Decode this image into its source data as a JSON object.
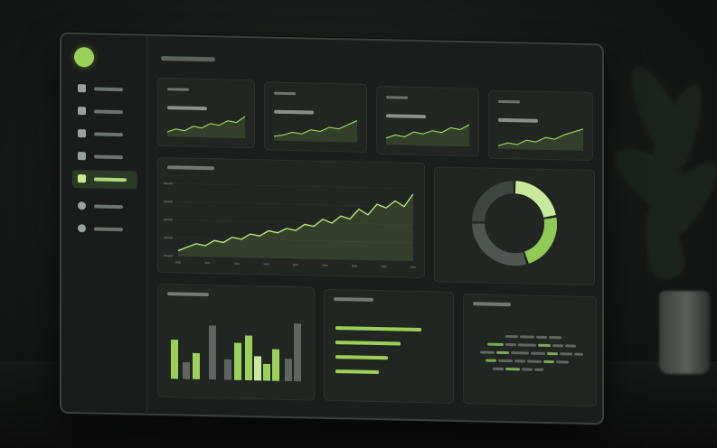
{
  "theme": {
    "accent": "#9bd159",
    "accent_light": "#c9ea9c",
    "panel": "#222623",
    "background": "#151816"
  },
  "sidebar": {
    "logo_icon": "logo-circle-icon",
    "items": [
      {
        "icon": "home-icon",
        "label": "",
        "active": false
      },
      {
        "icon": "box-icon",
        "label": "",
        "active": false
      },
      {
        "icon": "grid-icon",
        "label": "",
        "active": false
      },
      {
        "icon": "calendar-icon",
        "label": "",
        "active": false
      },
      {
        "icon": "chart-icon",
        "label": "",
        "active": true
      },
      {
        "icon": "user-icon",
        "label": "",
        "active": false
      },
      {
        "icon": "settings-icon",
        "label": "",
        "active": false
      }
    ]
  },
  "header": {
    "title": ""
  },
  "kpi_cards": [
    {
      "title": "",
      "value": ""
    },
    {
      "title": "",
      "value": ""
    },
    {
      "title": "",
      "value": ""
    },
    {
      "title": "",
      "value": ""
    }
  ],
  "panels": {
    "line_title": "",
    "bar_title": "",
    "list_title": "",
    "tags_title": ""
  },
  "chart_data": [
    {
      "type": "line",
      "x": [
        1,
        2,
        3,
        4,
        5,
        6,
        7,
        8,
        9,
        10,
        11,
        12,
        13,
        14,
        15,
        16,
        17,
        18,
        19,
        20,
        21,
        22,
        23,
        24,
        25,
        26,
        27
      ],
      "values": [
        6,
        10,
        14,
        12,
        18,
        16,
        22,
        20,
        26,
        24,
        30,
        28,
        33,
        31,
        38,
        36,
        44,
        40,
        48,
        45,
        56,
        50,
        62,
        58,
        66,
        60,
        74
      ]
    },
    {
      "type": "pie",
      "values": [
        22,
        23,
        30,
        25
      ]
    },
    {
      "type": "bar",
      "values": [
        42,
        18,
        28,
        58,
        22,
        40,
        48,
        26,
        18,
        34,
        24,
        62
      ]
    },
    {
      "type": "bar",
      "values": [
        95,
        72,
        58,
        48
      ]
    }
  ]
}
